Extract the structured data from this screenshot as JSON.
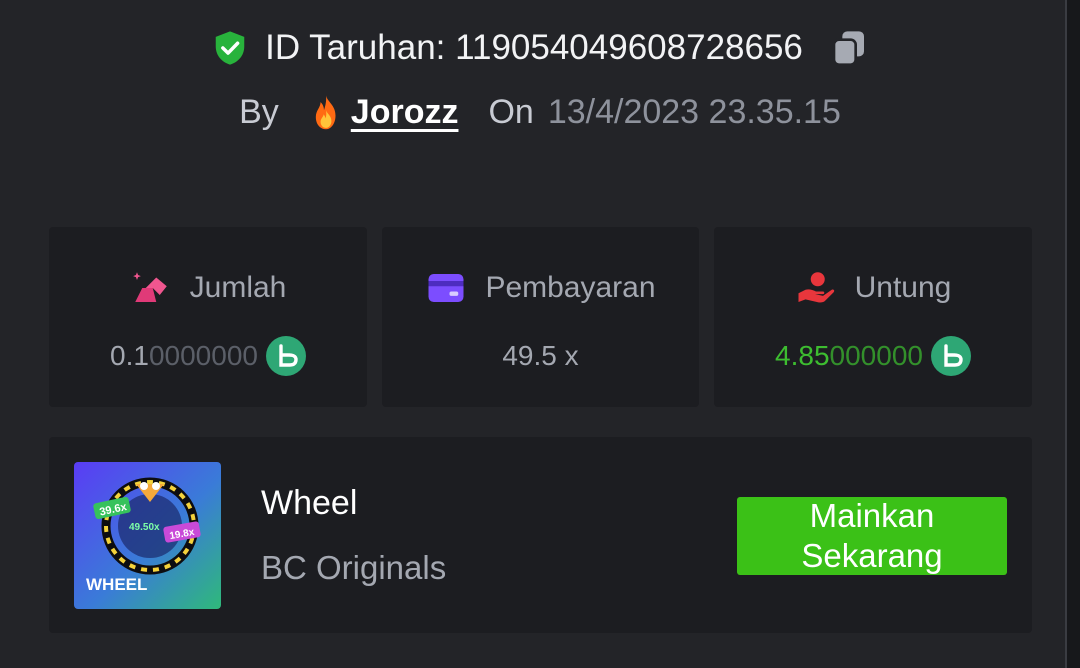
{
  "header": {
    "bet_id_label": "ID Taruhan: 119054049608728656",
    "by_label": "By",
    "username": "Jorozz",
    "on_label": "On",
    "datetime": "13/4/2023 23.35.15"
  },
  "stats": [
    {
      "label": "Jumlah",
      "value_main": "0.1",
      "value_dim": "0000000",
      "icon": "bet-amount-icon"
    },
    {
      "label": "Pembayaran",
      "value": "49.5 x",
      "icon": "card-icon"
    },
    {
      "label": "Untung",
      "value_main": "4.85",
      "value_dim": "000000",
      "icon": "profit-hand-icon"
    }
  ],
  "game": {
    "thumb_title": "WHEEL",
    "thumb_labels": [
      "39.6x",
      "49.50x",
      "19.8x"
    ],
    "title": "Wheel",
    "provider": "BC Originals",
    "play_label": "Mainkan\nSekarang"
  },
  "colors": {
    "background": "#232428",
    "card": "#1c1d21",
    "accent_green": "#3bc117",
    "profit_green": "#3dbd30",
    "coin": "#2ea775"
  }
}
